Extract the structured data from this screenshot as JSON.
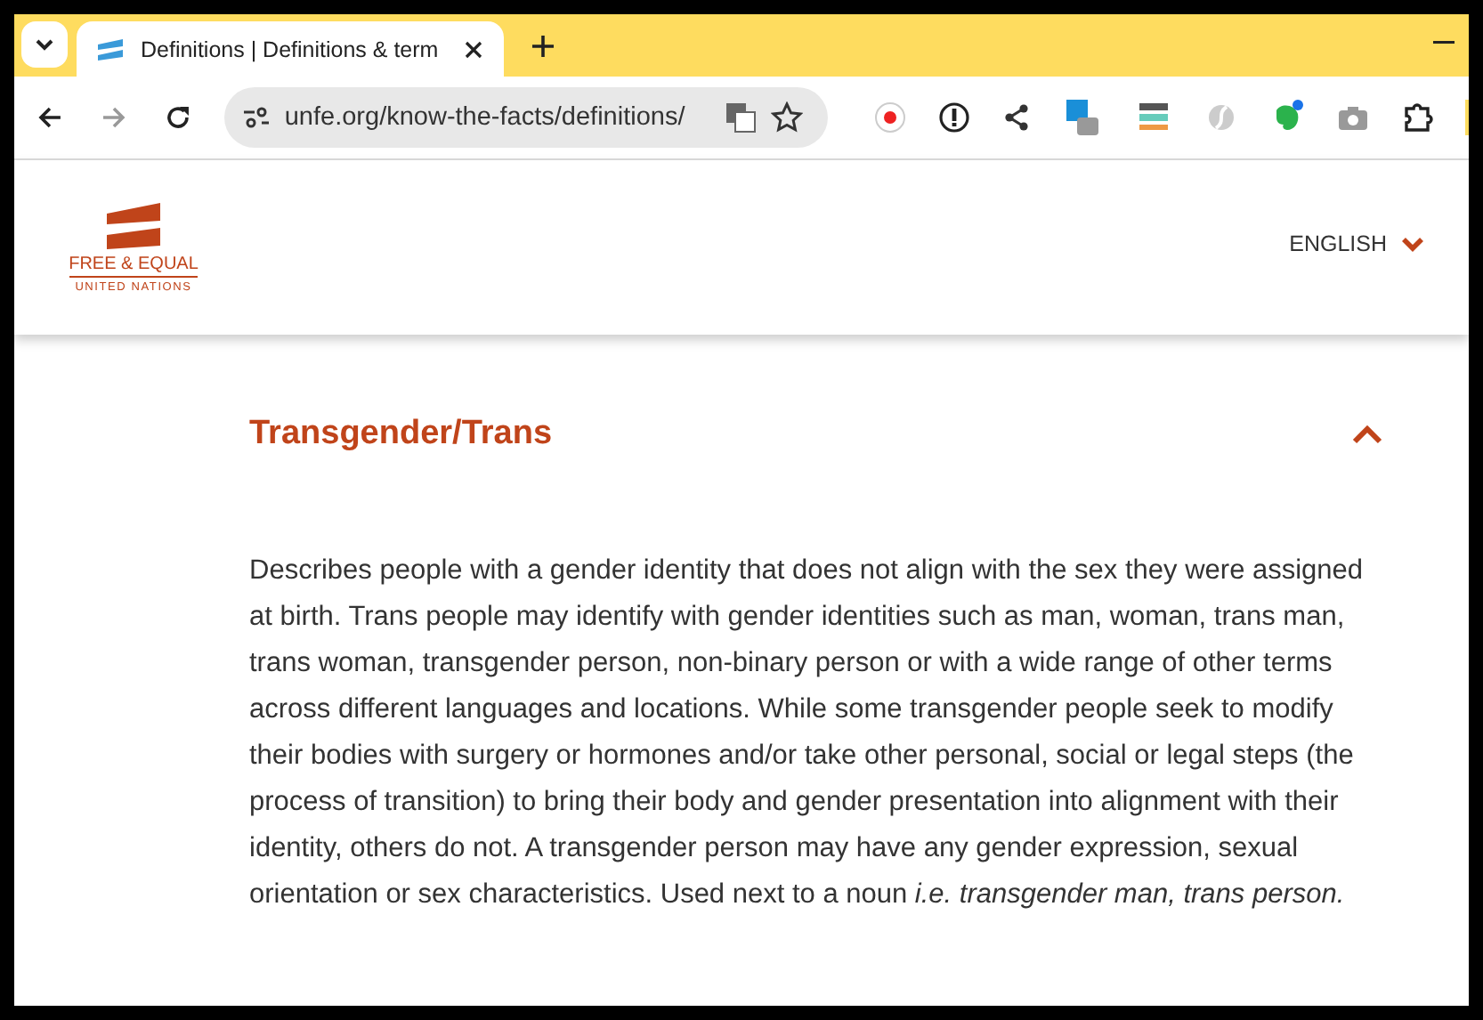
{
  "browser": {
    "tab": {
      "title": "Definitions | Definitions & term",
      "selected": true
    },
    "address": "unfe.org/know-the-facts/definitions/"
  },
  "header": {
    "logo": {
      "line_1": "FREE & EQUAL",
      "line_2": "UNITED NATIONS"
    },
    "language": "ENGLISH"
  },
  "section": {
    "title": "Transgender/Trans",
    "expanded": true,
    "body": "Describes people with a gender identity that does not align with the sex they were assigned at birth. Trans people may identify with gender identities such as man, woman, trans man, trans woman, transgender person, non-binary person or with a wide range of other terms across different languages and locations. While some transgender people seek to modify their bodies with surgery or hormones and/or take other personal, social or legal steps (the process of transition) to bring their body and gender presentation into alignment with their identity, others do not. A transgender person may have any gender expression, sexual orientation or sex characteristics. Used next to a noun *i.e. transgender man, trans person.*"
  }
}
